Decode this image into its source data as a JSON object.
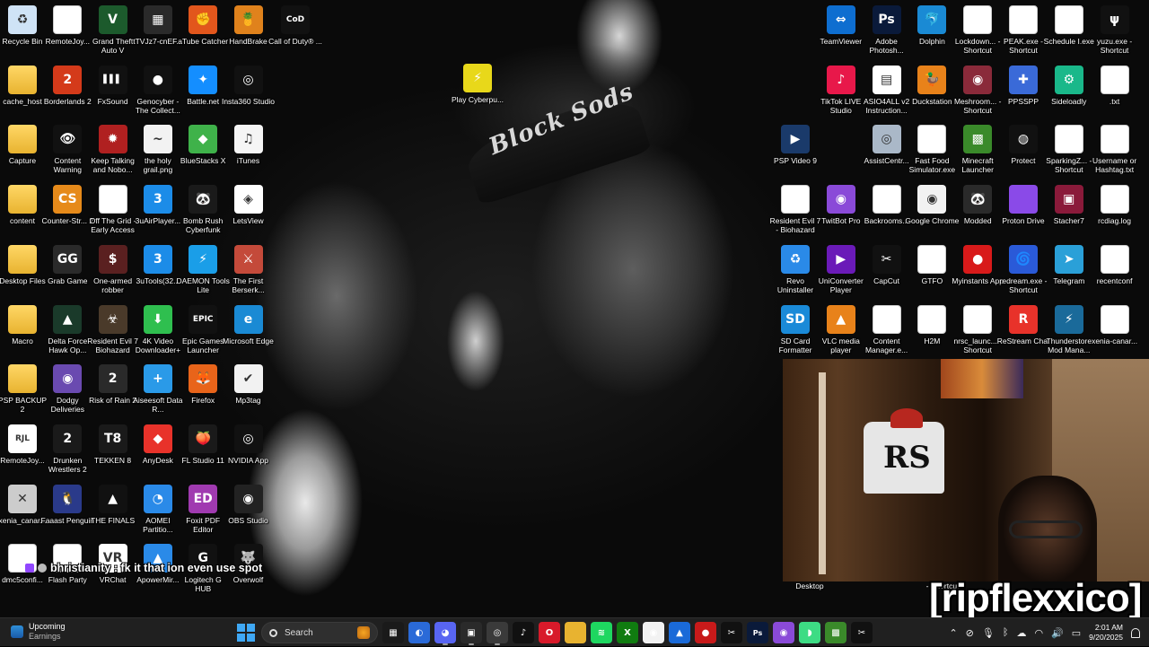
{
  "desktop_icons": [
    {
      "label": "Recycle Bin",
      "icon": "recycle-bin-icon",
      "bg": "#cfe3f6",
      "glyph": "♻"
    },
    {
      "label": "RemoteJoy...",
      "icon": "file-icon",
      "bg": "#ffffff",
      "glyph": ""
    },
    {
      "label": "Grand Theft Auto V",
      "icon": "gta-v-icon",
      "bg": "#1c5a2c",
      "glyph": "V"
    },
    {
      "label": "tTVJz7-cnEF...",
      "icon": "image-file-icon",
      "bg": "#2a2a2a",
      "glyph": "▦"
    },
    {
      "label": "aTube Catcher",
      "icon": "atube-catcher-icon",
      "bg": "#e2561c",
      "glyph": "✊"
    },
    {
      "label": "HandBrake",
      "icon": "handbrake-icon",
      "bg": "#e0821c",
      "glyph": "🍍"
    },
    {
      "label": "Call of Duty® ...",
      "icon": "call-of-duty-icon",
      "bg": "#111111",
      "glyph": "CoD"
    },
    {
      "label": "cache_host",
      "icon": "folder-icon",
      "bg": "folder",
      "glyph": ""
    },
    {
      "label": "Borderlands 2",
      "icon": "borderlands-icon",
      "bg": "#d43a1a",
      "glyph": "2"
    },
    {
      "label": "FxSound",
      "icon": "fxsound-icon",
      "bg": "#111111",
      "glyph": "▌▌▌"
    },
    {
      "label": "Genocyber - The Collect...",
      "icon": "video-icon",
      "bg": "#111111",
      "glyph": "●"
    },
    {
      "label": "Battle.net",
      "icon": "battlenet-icon",
      "bg": "#148eff",
      "glyph": "✦"
    },
    {
      "label": "Insta360 Studio",
      "icon": "insta360-icon",
      "bg": "#111111",
      "glyph": "◎"
    },
    {
      "label": "Capture",
      "icon": "folder-icon",
      "bg": "folder",
      "glyph": ""
    },
    {
      "label": "Content Warning",
      "icon": "content-warning-icon",
      "bg": "#111111",
      "glyph": "👁"
    },
    {
      "label": "Keep Talking and Nobo...",
      "icon": "keep-talking-icon",
      "bg": "#b02020",
      "glyph": "✹"
    },
    {
      "label": "the holy grail.png",
      "icon": "image-file-icon",
      "bg": "#f2f2f2",
      "glyph": "~"
    },
    {
      "label": "BlueStacks X",
      "icon": "bluestacks-icon",
      "bg": "#3fb24a",
      "glyph": "◆"
    },
    {
      "label": "iTunes",
      "icon": "itunes-icon",
      "bg": "#f5f5f5",
      "glyph": "♫"
    },
    {
      "label": "content",
      "icon": "folder-icon",
      "bg": "folder",
      "glyph": ""
    },
    {
      "label": "Counter-Str... 2",
      "icon": "counter-strike-icon",
      "bg": "#e68a1a",
      "glyph": "CS"
    },
    {
      "label": "Off The Grid - Early Access",
      "icon": "file-icon",
      "bg": "#ffffff",
      "glyph": ""
    },
    {
      "label": "3uAirPlayer...",
      "icon": "3uairplayer-icon",
      "bg": "#1c8ce8",
      "glyph": "3"
    },
    {
      "label": "Bomb Rush Cyberfunk",
      "icon": "bomb-rush-icon",
      "bg": "#1a1a1a",
      "glyph": "🐼"
    },
    {
      "label": "LetsView",
      "icon": "letsview-icon",
      "bg": "#ffffff",
      "glyph": "◈"
    },
    {
      "label": "Desktop Files",
      "icon": "folder-icon",
      "bg": "folder",
      "glyph": ""
    },
    {
      "label": "Grab Game",
      "icon": "grab-game-icon",
      "bg": "#2a2a2a",
      "glyph": "GG"
    },
    {
      "label": "One-armed robber",
      "icon": "one-armed-robber-icon",
      "bg": "#5a2020",
      "glyph": "$"
    },
    {
      "label": "3uTools(32...",
      "icon": "3utools-icon",
      "bg": "#1c8ce8",
      "glyph": "3"
    },
    {
      "label": "DAEMON Tools Lite",
      "icon": "daemon-tools-icon",
      "bg": "#1a9ee8",
      "glyph": "⚡"
    },
    {
      "label": "The First Berserk...",
      "icon": "first-berserker-icon",
      "bg": "#c44a3a",
      "glyph": "⚔"
    },
    {
      "label": "Macro",
      "icon": "folder-icon",
      "bg": "folder",
      "glyph": ""
    },
    {
      "label": "Delta Force Hawk Op...",
      "icon": "delta-force-icon",
      "bg": "#1a3a2a",
      "glyph": "▲"
    },
    {
      "label": "Resident Evil 7 Biohazard",
      "icon": "resident-evil-icon",
      "bg": "#4a3a2a",
      "glyph": "☣"
    },
    {
      "label": "4K Video Downloader+",
      "icon": "4k-video-icon",
      "bg": "#2fbf4f",
      "glyph": "⬇"
    },
    {
      "label": "Epic Games Launcher",
      "icon": "epic-games-icon",
      "bg": "#111111",
      "glyph": "EPIC"
    },
    {
      "label": "Microsoft Edge",
      "icon": "edge-icon",
      "bg": "#1a8ad4",
      "glyph": "e"
    },
    {
      "label": "PSP BACKUP 2",
      "icon": "folder-icon",
      "bg": "folder",
      "glyph": ""
    },
    {
      "label": "Dodgy Deliveries",
      "icon": "dodgy-deliveries-icon",
      "bg": "#6a4ab0",
      "glyph": "◉"
    },
    {
      "label": "Risk of Rain 2",
      "icon": "risk-of-rain-icon",
      "bg": "#2a2a2a",
      "glyph": "2"
    },
    {
      "label": "Aiseesoft Data R...",
      "icon": "aiseesoft-icon",
      "bg": "#2a9ae8",
      "glyph": "+"
    },
    {
      "label": "Firefox",
      "icon": "firefox-icon",
      "bg": "#e8641a",
      "glyph": "🦊"
    },
    {
      "label": "Mp3tag",
      "icon": "mp3tag-icon",
      "bg": "#f2f2f2",
      "glyph": "✔"
    },
    {
      "label": "RemoteJoy...",
      "icon": "remotejoy-icon",
      "bg": "#ffffff",
      "glyph": "RJL"
    },
    {
      "label": "Drunken Wrestlers 2",
      "icon": "drunken-wrestlers-icon",
      "bg": "#1a1a1a",
      "glyph": "2"
    },
    {
      "label": "TEKKEN 8",
      "icon": "tekken-icon",
      "bg": "#1a1a1a",
      "glyph": "T8"
    },
    {
      "label": "AnyDesk",
      "icon": "anydesk-icon",
      "bg": "#e8322a",
      "glyph": "◆"
    },
    {
      "label": "FL Studio 11",
      "icon": "fl-studio-icon",
      "bg": "#1a1a1a",
      "glyph": "🍑"
    },
    {
      "label": "NVIDIA App",
      "icon": "nvidia-icon",
      "bg": "#111111",
      "glyph": "◎"
    },
    {
      "label": "xenia_canar...",
      "icon": "xenia-icon",
      "bg": "#cccccc",
      "glyph": "✕"
    },
    {
      "label": "Faaast Penguin",
      "icon": "faaast-penguin-icon",
      "bg": "#2a3a8a",
      "glyph": "🐧"
    },
    {
      "label": "THE FINALS",
      "icon": "the-finals-icon",
      "bg": "#111111",
      "glyph": "▲"
    },
    {
      "label": "AOMEI Partitio...",
      "icon": "aomei-icon",
      "bg": "#2a8ae8",
      "glyph": "◔"
    },
    {
      "label": "Foxit PDF Editor",
      "icon": "foxit-icon",
      "bg": "#a03ab0",
      "glyph": "ED"
    },
    {
      "label": "OBS Studio",
      "icon": "obs-icon",
      "bg": "#222222",
      "glyph": "◉"
    },
    {
      "label": "dmc5confi...",
      "icon": "file-icon",
      "bg": "#ffffff",
      "glyph": ""
    },
    {
      "label": "Flash Party",
      "icon": "file-icon",
      "bg": "#ffffff",
      "glyph": ""
    },
    {
      "label": "VRChat",
      "icon": "vrchat-icon",
      "bg": "#ffffff",
      "glyph": "VR"
    },
    {
      "label": "ApowerMir...",
      "icon": "apowermirror-icon",
      "bg": "#2a8ae8",
      "glyph": "▲"
    },
    {
      "label": "Logitech G HUB",
      "icon": "logitech-icon",
      "bg": "#111111",
      "glyph": "G"
    },
    {
      "label": "Overwolf",
      "icon": "overwolf-icon",
      "bg": "#111111",
      "glyph": "🐺"
    },
    {
      "label": "Play Cyberpu...",
      "icon": "cyberpunk-icon",
      "bg": "#e8d81a",
      "glyph": "⚡"
    }
  ],
  "right_icons": [
    {
      "label": "TeamViewer",
      "icon": "teamviewer-icon",
      "bg": "#0e6ed0",
      "glyph": "⇔"
    },
    {
      "label": "Adobe Photosh...",
      "icon": "photoshop-icon",
      "bg": "#0a1a3a",
      "glyph": "Ps"
    },
    {
      "label": "Dolphin",
      "icon": "dolphin-icon",
      "bg": "#1a8ad4",
      "glyph": "🐬"
    },
    {
      "label": "Lockdown... - Shortcut",
      "icon": "shortcut-icon",
      "bg": "#ffffff",
      "glyph": ""
    },
    {
      "label": "PEAK.exe - Shortcut",
      "icon": "shortcut-icon",
      "bg": "#ffffff",
      "glyph": ""
    },
    {
      "label": "Schedule I.exe",
      "icon": "shortcut-icon",
      "bg": "#ffffff",
      "glyph": ""
    },
    {
      "label": "yuzu.exe - Shortcut",
      "icon": "yuzu-icon",
      "bg": "#111111",
      "glyph": "ψ"
    },
    {
      "label": "TikTok LIVE Studio",
      "icon": "tiktok-icon",
      "bg": "#e8184a",
      "glyph": "♪"
    },
    {
      "label": "ASIO4ALL v2 Instruction...",
      "icon": "document-icon",
      "bg": "#ffffff",
      "glyph": "▤"
    },
    {
      "label": "Duckstation",
      "icon": "duckstation-icon",
      "bg": "#e8821a",
      "glyph": "🦆"
    },
    {
      "label": "Meshroom... - Shortcut",
      "icon": "shortcut-icon",
      "bg": "#8a2a3a",
      "glyph": "◉"
    },
    {
      "label": "PPSSPP",
      "icon": "ppsspp-icon",
      "bg": "#3a6ad8",
      "glyph": "✚"
    },
    {
      "label": "Sideloadly",
      "icon": "sideloadly-icon",
      "bg": "#1ab88a",
      "glyph": "⚙"
    },
    {
      "label": ".txt",
      "icon": "text-file-icon",
      "bg": "#ffffff",
      "glyph": ""
    },
    {
      "label": "PSP Video 9",
      "icon": "psp-video-icon",
      "bg": "#1a3a6a",
      "glyph": "▶"
    },
    {
      "label": "AssistCentr...",
      "icon": "assist-center-icon",
      "bg": "#aab8c8",
      "glyph": "◎"
    },
    {
      "label": "Fast Food Simulator.exe",
      "icon": "shortcut-icon",
      "bg": "#ffffff",
      "glyph": ""
    },
    {
      "label": "Minecraft Launcher",
      "icon": "minecraft-icon",
      "bg": "#3a8a2a",
      "glyph": "▩"
    },
    {
      "label": "Protect",
      "icon": "fingerprint-icon",
      "bg": "#111111",
      "glyph": "◍"
    },
    {
      "label": "SparkingZ... - Shortcut",
      "icon": "shortcut-icon",
      "bg": "#ffffff",
      "glyph": ""
    },
    {
      "label": "Username or Hashtag.txt",
      "icon": "text-file-icon",
      "bg": "#ffffff",
      "glyph": ""
    },
    {
      "label": "Resident Evil 7 - Biohazard",
      "icon": "shortcut-icon",
      "bg": "#ffffff",
      "glyph": ""
    },
    {
      "label": "TwitBot Pro",
      "icon": "twitbot-icon",
      "bg": "#8a4ad8",
      "glyph": "◉"
    },
    {
      "label": "Backrooms...",
      "icon": "shortcut-icon",
      "bg": "#ffffff",
      "glyph": ""
    },
    {
      "label": "Google Chrome",
      "icon": "chrome-icon",
      "bg": "#f2f2f2",
      "glyph": "◉"
    },
    {
      "label": "Modded",
      "icon": "modded-icon",
      "bg": "#2a2a2a",
      "glyph": "🐼"
    },
    {
      "label": "Proton Drive",
      "icon": "folder-icon",
      "bg": "#8a4ae8",
      "glyph": ""
    },
    {
      "label": "Stacher7",
      "icon": "stacher-icon",
      "bg": "#8a1a3a",
      "glyph": "▣"
    },
    {
      "label": "rcdiag.log",
      "icon": "text-file-icon",
      "bg": "#ffffff",
      "glyph": ""
    },
    {
      "label": "Revo Uninstaller",
      "icon": "revo-icon",
      "bg": "#2a8ae8",
      "glyph": "♻"
    },
    {
      "label": "UniConverter Player",
      "icon": "uniconverter-icon",
      "bg": "#6a1ab8",
      "glyph": "▶"
    },
    {
      "label": "CapCut",
      "icon": "capcut-icon",
      "bg": "#111111",
      "glyph": "✂"
    },
    {
      "label": "GTFO",
      "icon": "shortcut-icon",
      "bg": "#ffffff",
      "glyph": ""
    },
    {
      "label": "Myinstants App",
      "icon": "myinstants-icon",
      "bg": "#d81a1a",
      "glyph": "●"
    },
    {
      "label": "redream.exe - Shortcut",
      "icon": "redream-icon",
      "bg": "#2a5ad8",
      "glyph": "🌀"
    },
    {
      "label": "Telegram",
      "icon": "telegram-icon",
      "bg": "#2aa0d8",
      "glyph": "➤"
    },
    {
      "label": "recentconf",
      "icon": "text-file-icon",
      "bg": "#ffffff",
      "glyph": ""
    },
    {
      "label": "SD Card Formatter",
      "icon": "sd-card-icon",
      "bg": "#1a8ad8",
      "glyph": "SD"
    },
    {
      "label": "VLC media player",
      "icon": "vlc-icon",
      "bg": "#e8821a",
      "glyph": "▲"
    },
    {
      "label": "Content Manager.e...",
      "icon": "shortcut-icon",
      "bg": "#ffffff",
      "glyph": ""
    },
    {
      "label": "H2M",
      "icon": "shortcut-icon",
      "bg": "#ffffff",
      "glyph": ""
    },
    {
      "label": "nrsc_launc... - Shortcut",
      "icon": "shortcut-icon",
      "bg": "#ffffff",
      "glyph": ""
    },
    {
      "label": "ReStream Chat",
      "icon": "restream-icon",
      "bg": "#e8322a",
      "glyph": "R"
    },
    {
      "label": "Thunderstore Mod Mana...",
      "icon": "thunderstore-icon",
      "bg": "#1a6a9a",
      "glyph": "⚡"
    },
    {
      "label": "xenia-canar...",
      "icon": "text-file-icon",
      "bg": "#ffffff",
      "glyph": ""
    }
  ],
  "hidden_labels": {
    "desktop": "Desktop",
    "shortcut": "- Shortcut"
  },
  "wallpaper_cap_text": "Block Sods",
  "webcam_shirt_text": "RS",
  "chat_message": "bhristianity : fk it that ion even use spot",
  "watermark": "[ripflexxico]",
  "taskbar": {
    "widget_title": "Upcoming",
    "widget_sub": "Earnings",
    "search_placeholder": "Search",
    "apps": [
      {
        "icon": "file-explorer-tray-icon",
        "bg": "#1a1a1a",
        "glyph": "▦"
      },
      {
        "icon": "copilot-icon",
        "bg": "#2a6ad8",
        "glyph": "◐"
      },
      {
        "icon": "discord-icon",
        "bg": "#5865f2",
        "glyph": "◕",
        "active": true
      },
      {
        "icon": "capture-tool-icon",
        "bg": "#2a2a2a",
        "glyph": "▣",
        "active": true
      },
      {
        "icon": "chrome-alt-icon",
        "bg": "#3a3a3a",
        "glyph": "◎",
        "active": true
      },
      {
        "icon": "tiktok-taskbar-icon",
        "bg": "#111111",
        "glyph": "♪"
      },
      {
        "icon": "opera-icon",
        "bg": "#d81a2a",
        "glyph": "O"
      },
      {
        "icon": "folder-taskbar-icon",
        "bg": "#e8b330",
        "glyph": ""
      },
      {
        "icon": "spotify-icon",
        "bg": "#1ed760",
        "glyph": "≋"
      },
      {
        "icon": "xbox-icon",
        "bg": "#107c10",
        "glyph": "X"
      },
      {
        "icon": "google-chrome-taskbar-icon",
        "bg": "#f2f2f2",
        "glyph": "◉"
      },
      {
        "icon": "photos-icon",
        "bg": "#1a6ad8",
        "glyph": "▲"
      },
      {
        "icon": "record-icon",
        "bg": "#c81a1a",
        "glyph": "●"
      },
      {
        "icon": "capcut-taskbar-icon",
        "bg": "#111111",
        "glyph": "✂"
      },
      {
        "icon": "photoshop-taskbar-icon",
        "bg": "#0a1a3a",
        "glyph": "Ps"
      },
      {
        "icon": "twitbot-taskbar-icon",
        "bg": "#8a4ad8",
        "glyph": "◉"
      },
      {
        "icon": "android-icon",
        "bg": "#3ddc84",
        "glyph": "◗"
      },
      {
        "icon": "minecraft-taskbar-icon",
        "bg": "#3a8a2a",
        "glyph": "▩"
      },
      {
        "icon": "capcut-taskbar-icon-2",
        "bg": "#111111",
        "glyph": "✂"
      }
    ],
    "time": "2:01 AM",
    "date": "9/20/2025"
  }
}
